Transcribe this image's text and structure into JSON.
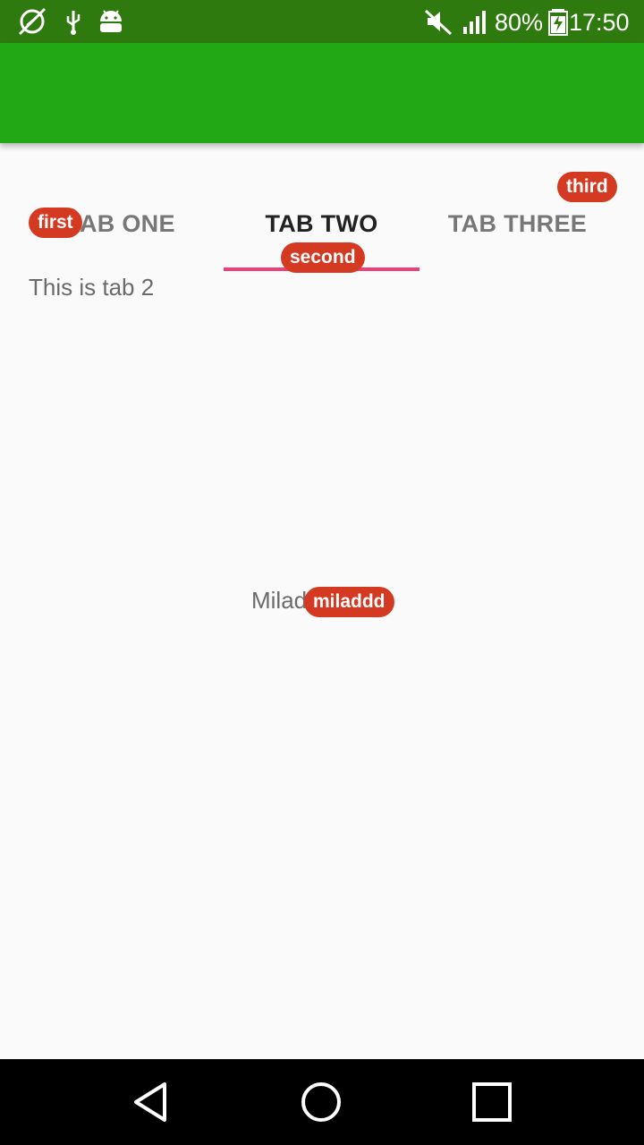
{
  "status_bar": {
    "battery_percent": "80%",
    "time": "17:50",
    "icons": [
      "no-location-icon",
      "usb-icon",
      "android-debug-icon",
      "mute-icon",
      "signal-icon",
      "battery-charging-icon"
    ]
  },
  "tabs": [
    {
      "label": "TAB ONE",
      "badge": "first",
      "active": false
    },
    {
      "label": "TAB TWO",
      "badge": "second",
      "active": true
    },
    {
      "label": "TAB THREE",
      "badge": "third",
      "active": false
    }
  ],
  "content": {
    "text": "This is tab 2",
    "center_text": "Milad",
    "center_badge": "miladdd"
  },
  "nav_bar": {
    "icons": [
      "back-icon",
      "home-icon",
      "recents-icon"
    ]
  },
  "colors": {
    "status_bar": "#2e7a0e",
    "app_bar": "#22a715",
    "indicator": "#ec407a",
    "badge": "#d43a22",
    "background": "#fafafa"
  }
}
